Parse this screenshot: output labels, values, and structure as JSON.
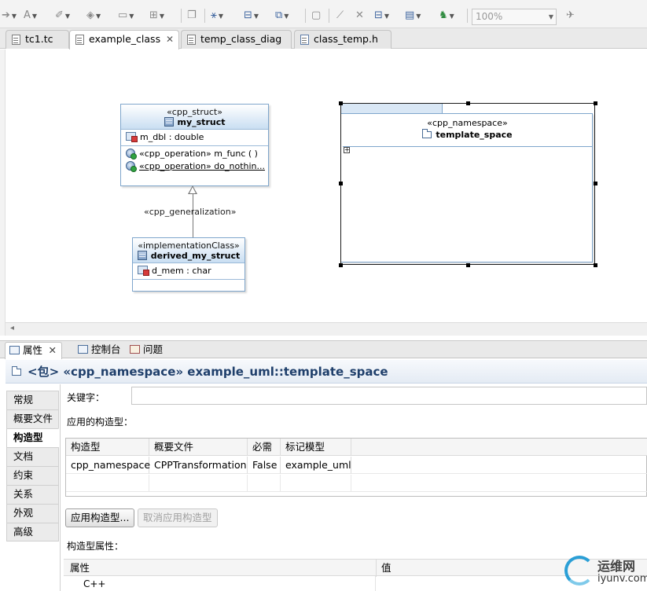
{
  "toolbar": {
    "zoom": "100%"
  },
  "editor_tabs": [
    {
      "label": "tc1.tc"
    },
    {
      "label": "example_class"
    },
    {
      "label": "temp_class_diag"
    },
    {
      "label": "class_temp.h"
    }
  ],
  "diagram": {
    "my_struct": {
      "stereotype": "«cpp_struct»",
      "name": "my_struct",
      "attributes": [
        "m_dbl : double"
      ],
      "operations": [
        "«cpp_operation» m_func ( )",
        "«cpp_operation» do_nothin..."
      ]
    },
    "generalization_label": "«cpp_generalization»",
    "derived": {
      "stereotype": "«implementationClass»",
      "name": "derived_my_struct",
      "attributes": [
        "d_mem : char"
      ]
    },
    "namespace": {
      "stereotype": "«cpp_namespace»",
      "name": "template_space"
    }
  },
  "view_tabs": [
    {
      "label": "属性"
    },
    {
      "label": "控制台"
    },
    {
      "label": "问题"
    }
  ],
  "properties": {
    "title": "<包> «cpp_namespace» example_uml::template_space",
    "side_tabs": [
      "常规",
      "概要文件",
      "构造型",
      "文档",
      "约束",
      "关系",
      "外观",
      "高级"
    ],
    "keyword_label": "关键字：",
    "keyword_value": "",
    "applied_label": "应用的构造型：",
    "columns": [
      "构造型",
      "概要文件",
      "必需",
      "标记模型"
    ],
    "rows": [
      [
        "cpp_namespace",
        "CPPTransformation",
        "False",
        "example_uml"
      ]
    ],
    "apply_button": "应用构造型...",
    "unapply_button": "取消应用构造型",
    "stereotype_props_label": "构造型属性：",
    "attr_columns": [
      "属性",
      "值"
    ],
    "attr_rows": [
      "C++"
    ]
  },
  "watermark": {
    "cn": "运维网",
    "url": "iyunv.com"
  }
}
